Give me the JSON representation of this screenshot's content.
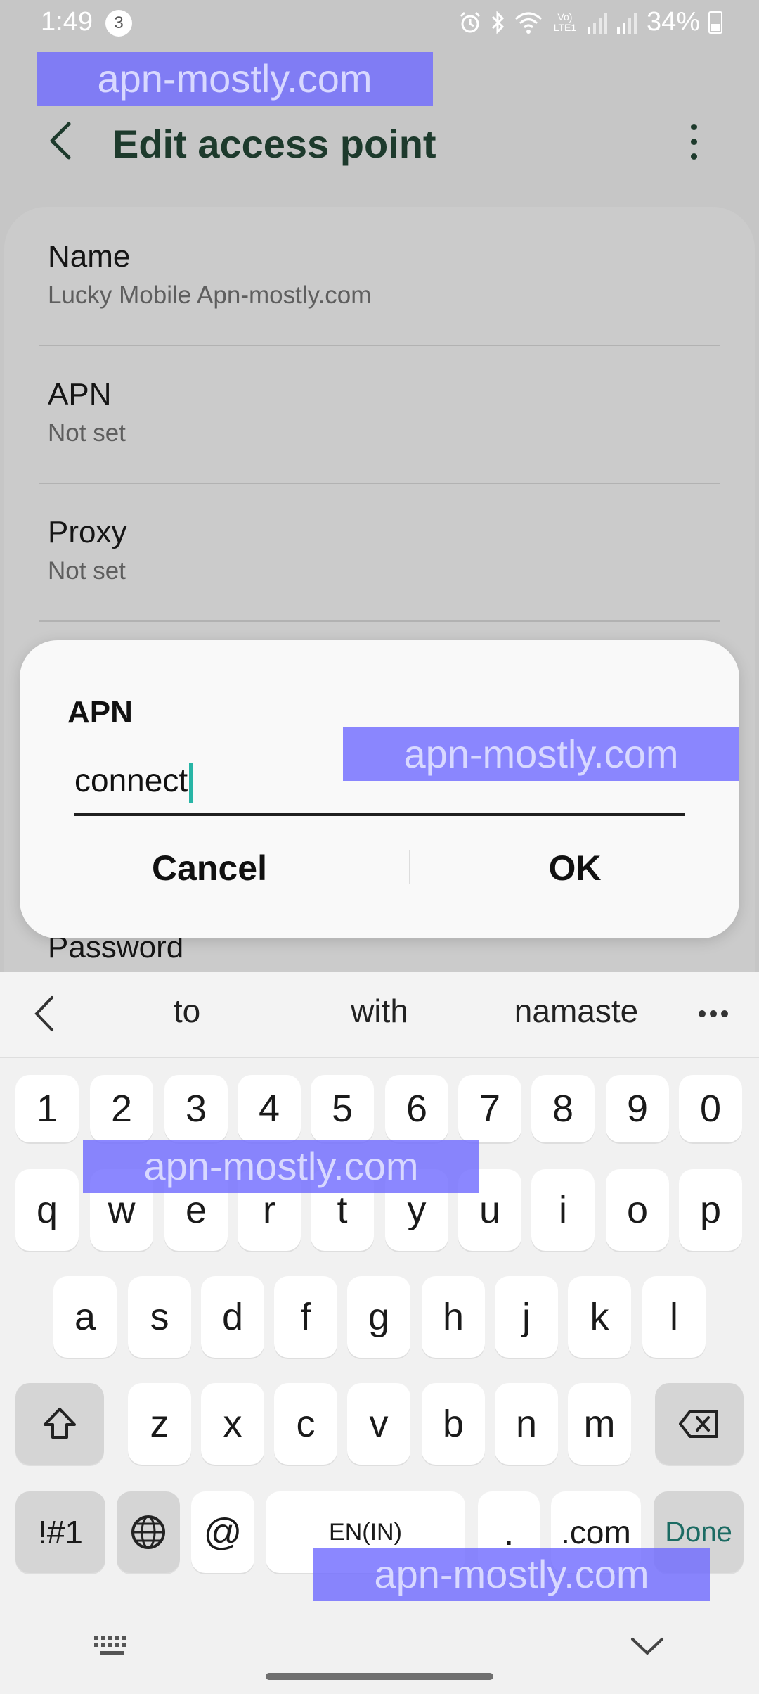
{
  "status_bar": {
    "time": "1:49",
    "notification_count": "3",
    "network_label": "Vo) LTE1",
    "battery": "34%"
  },
  "watermark": "apn-mostly.com",
  "app_bar": {
    "title": "Edit access point"
  },
  "settings": [
    {
      "title": "Name",
      "value": "Lucky Mobile Apn-mostly.com"
    },
    {
      "title": "APN",
      "value": "Not set"
    },
    {
      "title": "Proxy",
      "value": "Not set"
    },
    {
      "title": "Password",
      "value": ""
    }
  ],
  "dialog": {
    "title": "APN",
    "input_value": "connect",
    "cancel_label": "Cancel",
    "ok_label": "OK"
  },
  "keyboard": {
    "suggestions": [
      "to",
      "with",
      "namaste"
    ],
    "row_numbers": [
      "1",
      "2",
      "3",
      "4",
      "5",
      "6",
      "7",
      "8",
      "9",
      "0"
    ],
    "row_1": [
      "q",
      "w",
      "e",
      "r",
      "t",
      "y",
      "u",
      "i",
      "o",
      "p"
    ],
    "row_2": [
      "a",
      "s",
      "d",
      "f",
      "g",
      "h",
      "j",
      "k",
      "l"
    ],
    "row_3": [
      "z",
      "x",
      "c",
      "v",
      "b",
      "n",
      "m"
    ],
    "symbols_label": "!#1",
    "at_label": "@",
    "space_label": "EN(IN)",
    "dot_label": ".",
    "dotcom_label": ".com",
    "done_label": "Done"
  },
  "colors": {
    "title_text": "#1d3a2c",
    "caret": "#28b5a6",
    "done": "#1c6b63",
    "watermark": "#6e69ff"
  }
}
